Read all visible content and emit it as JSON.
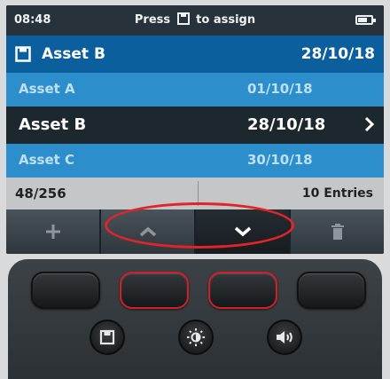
{
  "status": {
    "time": "08:48",
    "hint_prefix": "Press",
    "hint_suffix": "to assign",
    "battery_level": 0.7
  },
  "header": {
    "asset": "Asset B",
    "date": "28/10/18"
  },
  "list": [
    {
      "name": "Asset A",
      "date": "01/10/18"
    },
    {
      "name": "Asset B",
      "date": "28/10/18"
    },
    {
      "name": "Asset C",
      "date": "30/10/18"
    }
  ],
  "info": {
    "count": "48/256",
    "entries": "10 Entries"
  },
  "softkeys": [
    {
      "icon": "plus-icon"
    },
    {
      "icon": "chevron-up-icon"
    },
    {
      "icon": "chevron-down-icon"
    },
    {
      "icon": "trash-icon"
    }
  ],
  "hardware": {
    "round_buttons": [
      {
        "icon": "floppy-disk-icon"
      },
      {
        "icon": "brightness-icon"
      },
      {
        "icon": "volume-icon"
      }
    ]
  },
  "colors": {
    "header_blue": "#0b5f9d",
    "row_blue": "#2c8ecb",
    "selected_row": "#1d272e",
    "highlight_red": "#e0242a"
  }
}
